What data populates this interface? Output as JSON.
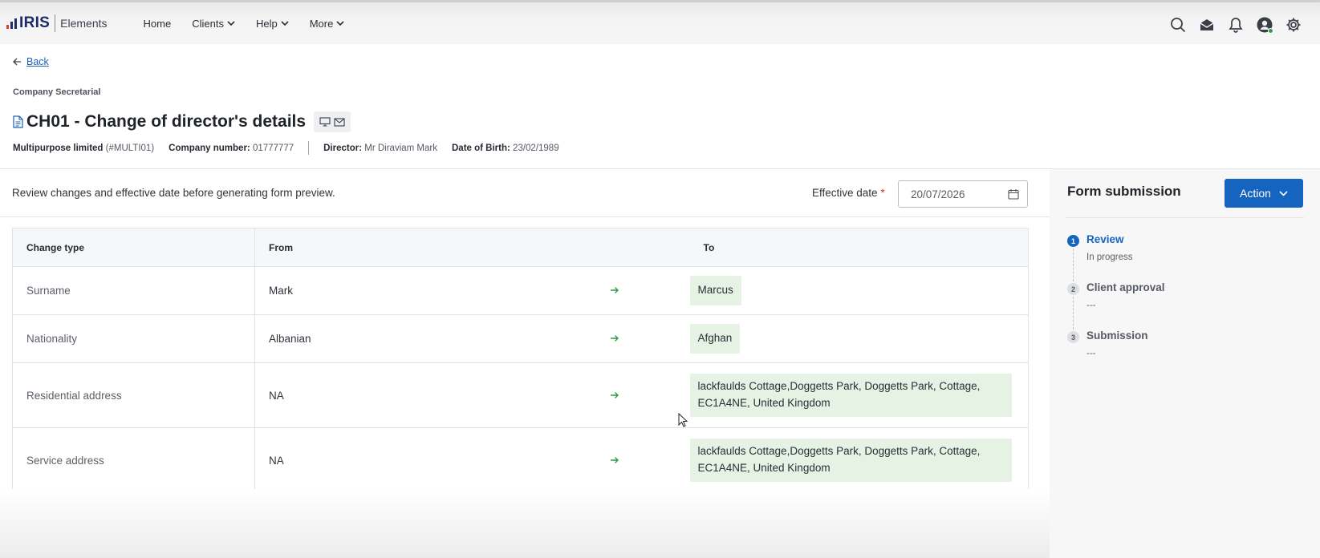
{
  "nav": {
    "brand": "IRIS",
    "product": "Elements",
    "items": [
      {
        "label": "Home",
        "has_dropdown": false
      },
      {
        "label": "Clients",
        "has_dropdown": true
      },
      {
        "label": "Help",
        "has_dropdown": true
      },
      {
        "label": "More",
        "has_dropdown": true
      }
    ],
    "icons": [
      "search-icon",
      "inbox-icon",
      "bell-icon",
      "user-avatar-icon",
      "gear-icon"
    ]
  },
  "header": {
    "back_label": "Back",
    "section": "Company Secretarial",
    "title": "CH01 - Change of director's details",
    "company_name": "Multipurpose limited",
    "company_code": "(#MULTI01)",
    "company_number_label": "Company number:",
    "company_number": "01777777",
    "director_label": "Director:",
    "director": "Mr Diraviam Mark",
    "dob_label": "Date of Birth:",
    "dob": "23/02/1989"
  },
  "main": {
    "instruction": "Review changes and effective date before generating form preview.",
    "effective_date_label": "Effective date",
    "required_mark": "*",
    "effective_date_value": "20/07/2026",
    "table": {
      "headers": {
        "change_type": "Change type",
        "from": "From",
        "to": "To"
      },
      "rows": [
        {
          "change_type": "Surname",
          "from": "Mark",
          "to": "Marcus"
        },
        {
          "change_type": "Nationality",
          "from": "Albanian",
          "to": "Afghan"
        },
        {
          "change_type": "Residential address",
          "from": "NA",
          "to": "lackfaulds Cottage,Doggetts Park, Doggetts Park, Cottage, EC1A4NE, United Kingdom"
        },
        {
          "change_type": "Service address",
          "from": "NA",
          "to": "lackfaulds Cottage,Doggetts Park, Doggetts Park, Cottage, EC1A4NE, United Kingdom"
        }
      ]
    }
  },
  "side": {
    "title": "Form submission",
    "action_label": "Action",
    "steps": [
      {
        "num": "1",
        "title": "Review",
        "status": "In progress",
        "active": true
      },
      {
        "num": "2",
        "title": "Client approval",
        "status": "---",
        "active": false
      },
      {
        "num": "3",
        "title": "Submission",
        "status": "---",
        "active": false
      }
    ]
  },
  "colors": {
    "accent": "#1565c0",
    "chip_bg": "#e6f2e4",
    "arrow": "#2e9c47",
    "required": "#d0322d"
  }
}
